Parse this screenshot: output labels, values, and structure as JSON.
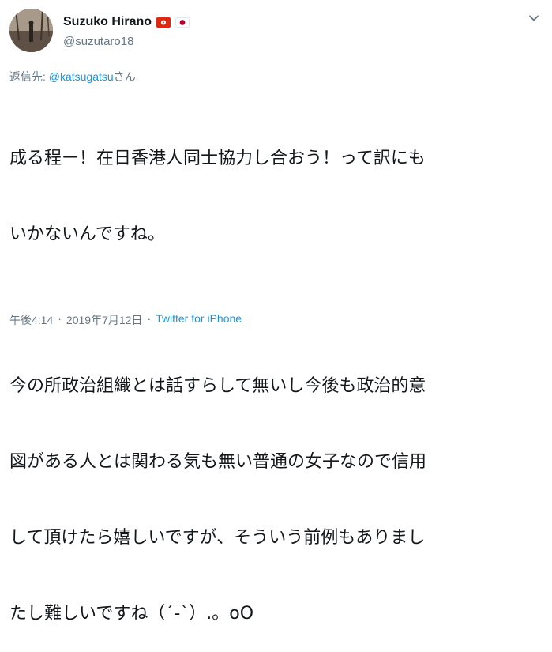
{
  "user": {
    "display_name": "Suzuko Hirano",
    "handle": "@suzutaro18",
    "flag_hk_color": "#de2910",
    "flag_jp_color": "#bc002d"
  },
  "reply": {
    "prefix": "返信先: ",
    "mention": "@katsugatsu",
    "suffix": "さん"
  },
  "tweet": {
    "text_line1": "成る程ー！在日香港人同士協力し合おう！って訳にも",
    "text_line2": "いかないんですね。",
    "text_line3": "今の所政治組織とは話すらして無いし今後も政治的意",
    "text_line4": "図がある人とは関わる気も無い普通の女子なので信用",
    "text_line5": "して頂けたら嬉しいですが、そういう前例もありまし",
    "text_line6": "たし難しいですね（´-`）.。oO"
  },
  "meta": {
    "time": "午後4:14",
    "separator1": "·",
    "date": "2019年7月12日",
    "separator2": "·",
    "source": "Twitter for iPhone"
  },
  "icons": {
    "more": "chevron-down-icon",
    "flag_hk": "hong-kong-flag-icon",
    "flag_jp": "japan-flag-icon"
  }
}
